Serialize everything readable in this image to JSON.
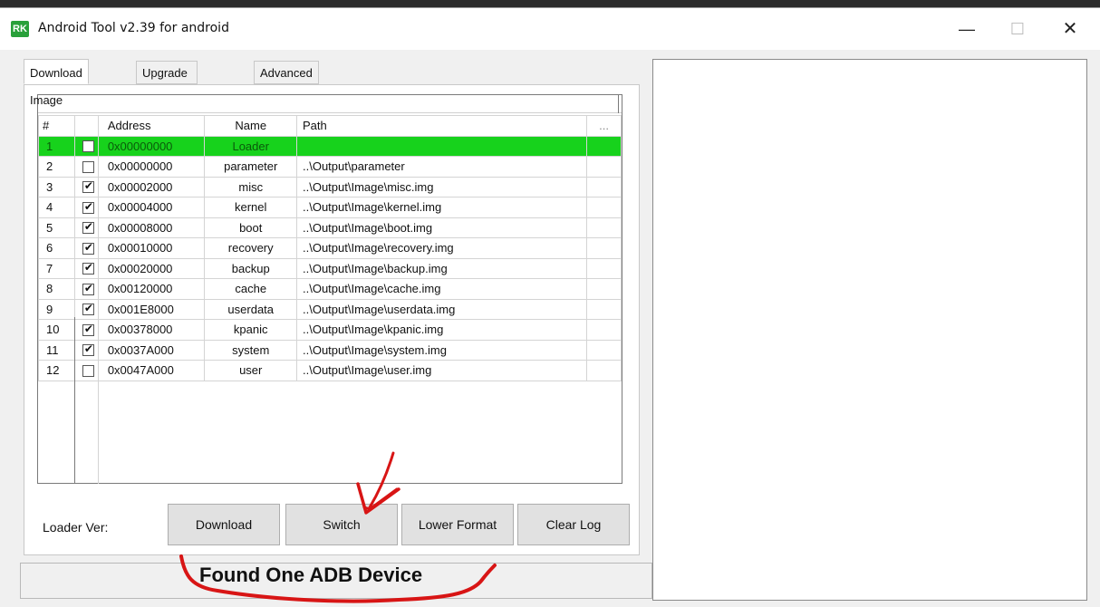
{
  "window": {
    "icon_text": "RK",
    "title": "Android Tool v2.39 for android",
    "minimize": "—",
    "maximize": "☐",
    "close": "✕"
  },
  "tabs": [
    {
      "label": "Download Image",
      "active": true
    },
    {
      "label": "Upgrade Firmware",
      "active": false
    },
    {
      "label": "Advanced Functions",
      "active": false
    }
  ],
  "table": {
    "headers": {
      "num": "#",
      "check": "",
      "address": "Address",
      "name": "Name",
      "path": "Path",
      "more": "..."
    },
    "rows": [
      {
        "num": "1",
        "checked": false,
        "address": "0x00000000",
        "name": "Loader",
        "path": "",
        "selected": true
      },
      {
        "num": "2",
        "checked": false,
        "address": "0x00000000",
        "name": "parameter",
        "path": "..\\Output\\parameter"
      },
      {
        "num": "3",
        "checked": true,
        "address": "0x00002000",
        "name": "misc",
        "path": "..\\Output\\Image\\misc.img"
      },
      {
        "num": "4",
        "checked": true,
        "address": "0x00004000",
        "name": "kernel",
        "path": "..\\Output\\Image\\kernel.img"
      },
      {
        "num": "5",
        "checked": true,
        "address": "0x00008000",
        "name": "boot",
        "path": "..\\Output\\Image\\boot.img"
      },
      {
        "num": "6",
        "checked": true,
        "address": "0x00010000",
        "name": "recovery",
        "path": "..\\Output\\Image\\recovery.img"
      },
      {
        "num": "7",
        "checked": true,
        "address": "0x00020000",
        "name": "backup",
        "path": "..\\Output\\Image\\backup.img"
      },
      {
        "num": "8",
        "checked": true,
        "address": "0x00120000",
        "name": "cache",
        "path": "..\\Output\\Image\\cache.img"
      },
      {
        "num": "9",
        "checked": true,
        "address": "0x001E8000",
        "name": "userdata",
        "path": "..\\Output\\Image\\userdata.img"
      },
      {
        "num": "10",
        "checked": true,
        "address": "0x00378000",
        "name": "kpanic",
        "path": "..\\Output\\Image\\kpanic.img"
      },
      {
        "num": "11",
        "checked": true,
        "address": "0x0037A000",
        "name": "system",
        "path": "..\\Output\\Image\\system.img"
      },
      {
        "num": "12",
        "checked": false,
        "address": "0x0047A000",
        "name": "user",
        "path": "..\\Output\\Image\\user.img"
      }
    ]
  },
  "controls": {
    "loader_label": "Loader Ver:",
    "download": "Download",
    "switch": "Switch",
    "lower_format": "Lower Format",
    "clear_log": "Clear Log"
  },
  "status": {
    "text": "Found One ADB Device"
  },
  "colors": {
    "selected_row": "#17d21c",
    "annotation": "#d81515"
  }
}
